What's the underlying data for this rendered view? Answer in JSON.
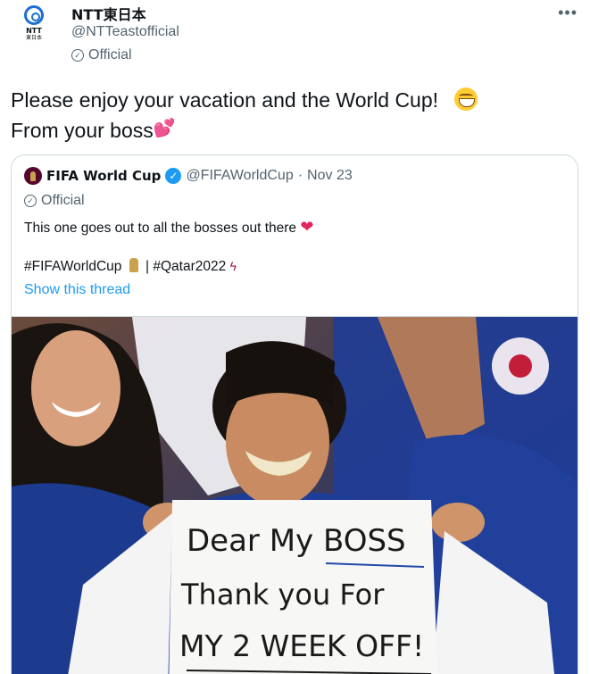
{
  "author": {
    "display_name": "NTT東日本",
    "handle": "@NTTeastofficial",
    "official_label": "Official",
    "logo_text": "NTT",
    "logo_sub": "東日本"
  },
  "tweet": {
    "line1": "Please enjoy your vacation and the World Cup!",
    "line2": "From your boss"
  },
  "quote": {
    "name": "FIFA World Cup",
    "handle": "@FIFAWorldCup",
    "separator": "·",
    "date": "Nov 23",
    "official_label": "Official",
    "text": "This one goes out to all the bosses out there",
    "tag1": "#FIFAWorldCup",
    "tag_sep": "|",
    "tag2": "#Qatar2022",
    "show_thread": "Show this thread"
  },
  "sign": {
    "line1": "Dear My BOSS",
    "line2": "Thank you For",
    "line3": "MY 2 WEEK OFF!"
  },
  "icons": {
    "more": "more-horizontal-icon",
    "official": "check-circle-icon",
    "verified": "verified-badge-icon",
    "emoji": "grinning-face-emoji",
    "hearts": "two-hearts-emoji",
    "heart": "red-heart-emoji",
    "trophy": "trophy-emoji",
    "ribbon": "ribbon-emoji"
  },
  "colors": {
    "link": "#1d9bf0",
    "secondary_text": "#536471",
    "border": "#cfd9de",
    "heart": "#e0245e"
  }
}
